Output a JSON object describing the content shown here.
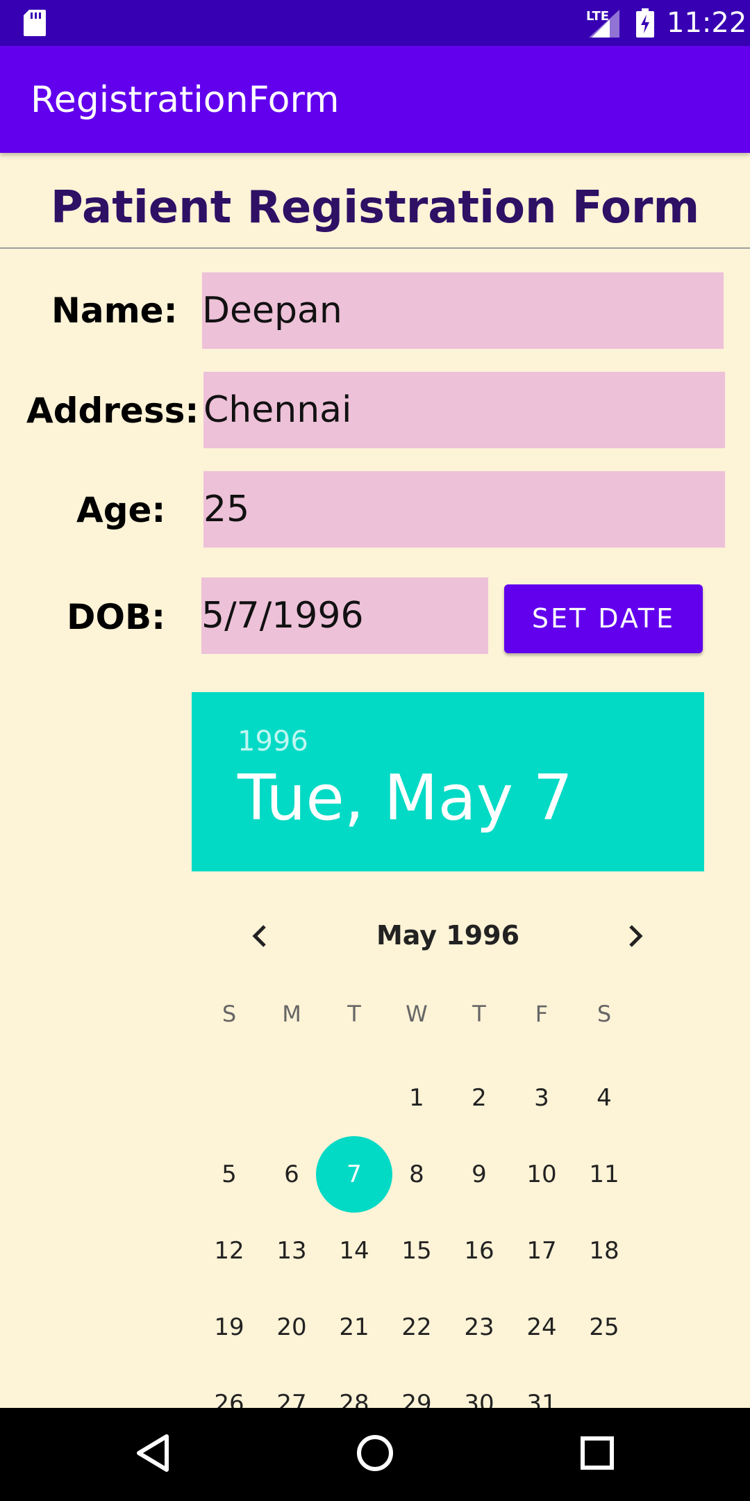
{
  "status_bar": {
    "network": "LTE",
    "time": "11:22",
    "icons": [
      "sd-card-icon",
      "signal-icon",
      "battery-charging-icon"
    ]
  },
  "app_bar": {
    "title": "RegistrationForm"
  },
  "form": {
    "title": "Patient Registration Form",
    "name": {
      "label": "Name:",
      "value": "Deepan"
    },
    "address": {
      "label": "Address:",
      "value": "Chennai"
    },
    "age": {
      "label": "Age:",
      "value": "25"
    },
    "dob": {
      "label": "DOB:",
      "value": "5/7/1996"
    },
    "set_date_label": "SET DATE"
  },
  "date_picker": {
    "year": "1996",
    "selected_date": "Tue, May 7",
    "month_label": "May 1996",
    "weekdays": [
      "S",
      "M",
      "T",
      "W",
      "T",
      "F",
      "S"
    ],
    "first_weekday_index": 3,
    "days_in_month": 31,
    "selected_day": 7,
    "accent_color": "#03DAC5",
    "icons": [
      "chevron-left-icon",
      "chevron-right-icon"
    ]
  },
  "nav_bar": {
    "icons": [
      "back-icon",
      "home-icon",
      "recents-icon"
    ]
  },
  "colors": {
    "status_bar": "#3700B3",
    "app_bar": "#6200EE",
    "background": "#FDF3D7",
    "field_background": "#EDC1D8",
    "title_color": "#2E1065"
  }
}
